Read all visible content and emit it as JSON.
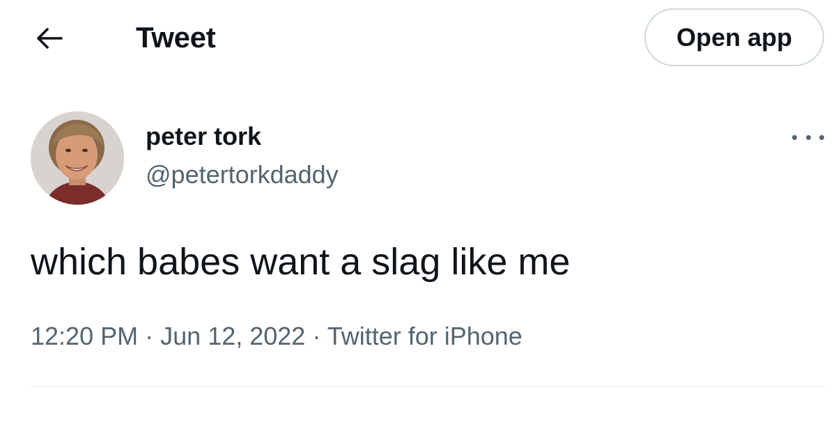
{
  "header": {
    "title": "Tweet",
    "back_icon": "arrow-left-icon",
    "open_app_label": "Open app"
  },
  "author": {
    "display_name": "peter tork",
    "username": "@petertorkdaddy",
    "avatar_icon": "profile-photo",
    "more_icon": "more-horizontal-icon"
  },
  "tweet": {
    "text": "which babes want a slag like me",
    "time": "12:20 PM",
    "separator": "·",
    "date": "Jun 12, 2022",
    "source": "Twitter for iPhone"
  },
  "colors": {
    "text_primary": "#0f1419",
    "text_secondary": "#536471",
    "border": "#cfd9de",
    "divider": "#eff3f4"
  }
}
